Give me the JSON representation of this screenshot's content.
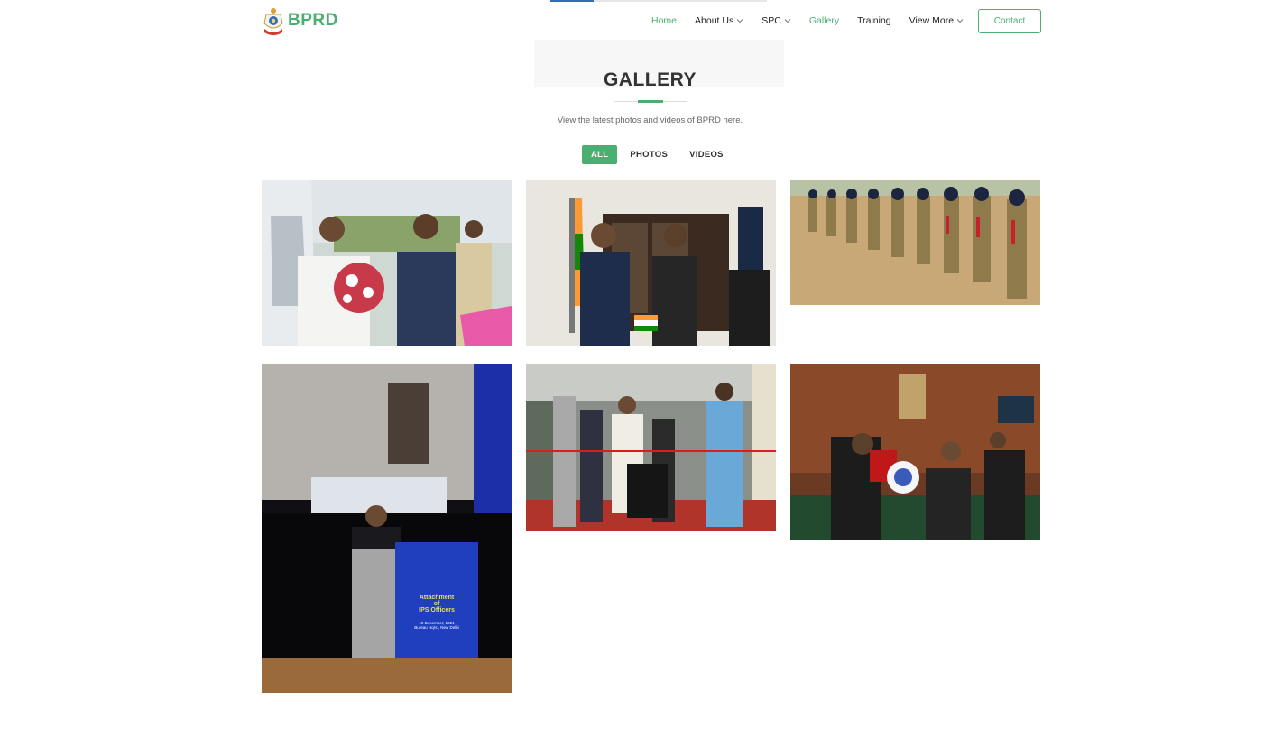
{
  "brand": {
    "name": "BPRD",
    "color": "#4caf72"
  },
  "nav": {
    "items": [
      {
        "label": "Home",
        "active": true,
        "dropdown": false
      },
      {
        "label": "About Us",
        "active": false,
        "dropdown": true
      },
      {
        "label": "SPC",
        "active": false,
        "dropdown": true
      },
      {
        "label": "Gallery",
        "active": false,
        "dropdown": false
      },
      {
        "label": "Training",
        "active": false,
        "dropdown": false
      },
      {
        "label": "View More",
        "active": false,
        "dropdown": true
      }
    ],
    "contact_label": "Contact"
  },
  "gallery": {
    "title": "GALLERY",
    "subtitle": "View the latest photos and videos of BPRD here.",
    "filters": [
      {
        "label": "ALL",
        "active": true
      },
      {
        "label": "PHOTOS",
        "active": false
      },
      {
        "label": "VIDEOS",
        "active": false
      }
    ],
    "photos": [
      {
        "name": "photo-bouquet-welcome"
      },
      {
        "name": "photo-handshake-office"
      },
      {
        "name": "photo-parade-march"
      },
      {
        "name": "photo-podium-speech",
        "podium_text": {
          "l1": "Attachment",
          "l2": "of",
          "l3": "IPS Officers",
          "l4": "10 December, 2021",
          "l5": "Bureau Hqrs., New Delhi"
        }
      },
      {
        "name": "photo-robot-demo"
      },
      {
        "name": "photo-award-presentation"
      }
    ]
  },
  "colors": {
    "accent": "#4caf72",
    "text": "#333333",
    "muted": "#666666"
  }
}
